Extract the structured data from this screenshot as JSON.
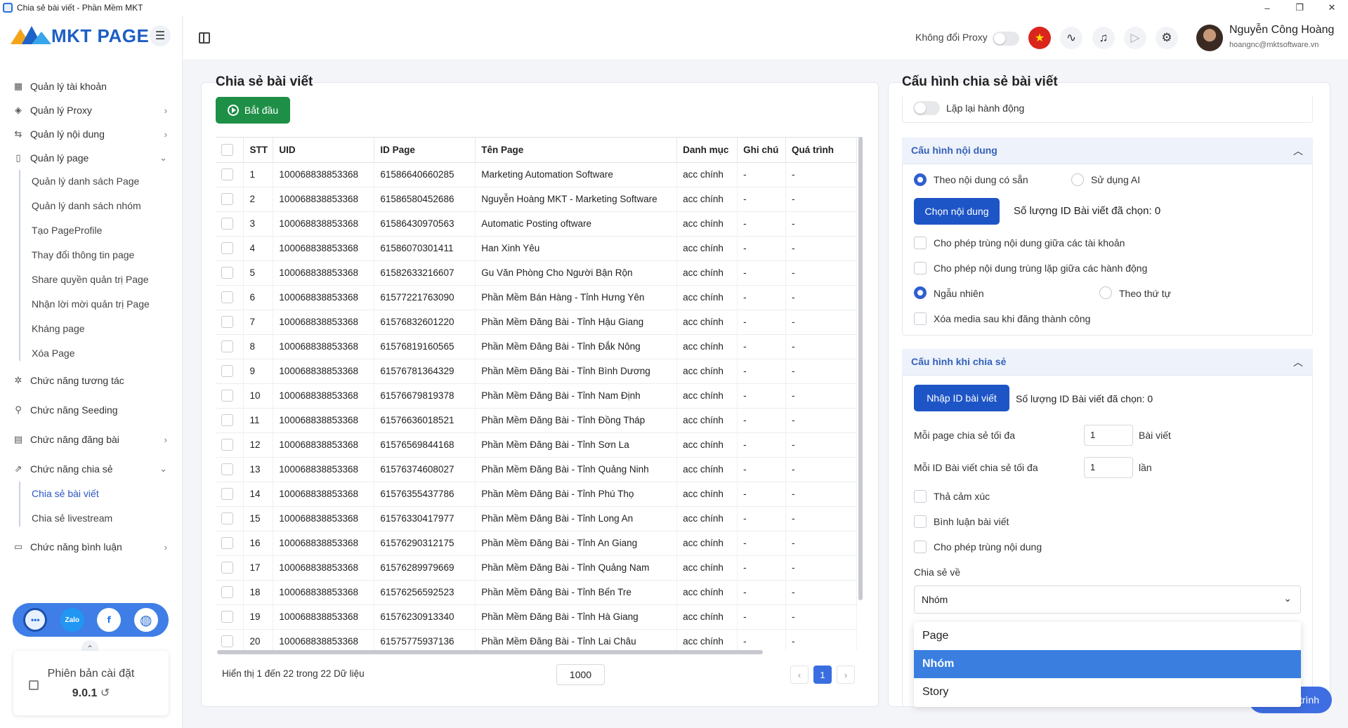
{
  "window": {
    "title": "Chia sẻ bài viết - Phần Mềm MKT",
    "minimize": "–",
    "maximize": "❐",
    "close": "✕"
  },
  "brand": {
    "name": "MKT PAGE"
  },
  "sidebar": {
    "items": [
      {
        "label": "Quản lý tài khoản",
        "icon": "grid-icon"
      },
      {
        "label": "Quản lý Proxy",
        "icon": "layers-icon"
      },
      {
        "label": "Quản lý nội dung",
        "icon": "shuffle-icon"
      },
      {
        "label": "Quản lý page",
        "icon": "document-icon"
      },
      {
        "label": "Chức năng tương tác",
        "icon": "sparkle-icon"
      },
      {
        "label": "Chức năng Seeding",
        "icon": "seed-icon"
      },
      {
        "label": "Chức năng đăng bài",
        "icon": "post-icon"
      },
      {
        "label": "Chức năng chia sẻ",
        "icon": "share-icon"
      },
      {
        "label": "Chức năng bình luận",
        "icon": "comment-icon"
      }
    ],
    "page_subitems": [
      "Quản lý danh sách Page",
      "Quản lý danh sách nhóm",
      "Tạo PageProfile",
      "Thay đổi thông tin page",
      "Share quyền quản trị Page",
      "Nhận lời mời quản trị Page",
      "Kháng page",
      "Xóa Page"
    ],
    "share_subitems": [
      "Chia sẻ bài viết",
      "Chia sẻ livestream"
    ],
    "social": {
      "zalo": "Zalo",
      "facebook": "f"
    },
    "version_label": "Phiên bản cài đặt",
    "version": "9.0.1"
  },
  "header": {
    "proxy_label": "Không đổi Proxy",
    "user_name": "Nguyễn Công Hoàng",
    "user_email": "hoangnc@mktsoftware.vn"
  },
  "left": {
    "title": "Chia sẻ bài viết",
    "start_button": "Bắt đầu",
    "columns": [
      "STT",
      "UID",
      "ID Page",
      "Tên Page",
      "Danh mục",
      "Ghi chú",
      "Quá trình"
    ],
    "rows": [
      [
        "1",
        "100068838853368",
        "61586640660285",
        "Marketing Automation Software",
        "acc chính",
        "-",
        "-"
      ],
      [
        "2",
        "100068838853368",
        "61586580452686",
        "Nguyễn Hoàng MKT - Marketing Software",
        "acc chính",
        "-",
        "-"
      ],
      [
        "3",
        "100068838853368",
        "61586430970563",
        "Automatic Posting oftware",
        "acc chính",
        "-",
        "-"
      ],
      [
        "4",
        "100068838853368",
        "61586070301411",
        "Han Xinh Yêu",
        "acc chính",
        "-",
        "-"
      ],
      [
        "5",
        "100068838853368",
        "61582633216607",
        "Gu Văn Phòng Cho Người Bận Rộn",
        "acc chính",
        "-",
        "-"
      ],
      [
        "6",
        "100068838853368",
        "61577221763090",
        "Phần Mềm Bán Hàng - Tỉnh Hưng Yên",
        "acc chính",
        "-",
        "-"
      ],
      [
        "7",
        "100068838853368",
        "61576832601220",
        "Phần Mềm Đăng Bài - Tỉnh Hậu Giang",
        "acc chính",
        "-",
        "-"
      ],
      [
        "8",
        "100068838853368",
        "61576819160565",
        "Phần Mềm Đăng Bài - Tỉnh Đắk Nông",
        "acc chính",
        "-",
        "-"
      ],
      [
        "9",
        "100068838853368",
        "61576781364329",
        "Phần Mềm Đăng Bài - Tỉnh Bình Dương",
        "acc chính",
        "-",
        "-"
      ],
      [
        "10",
        "100068838853368",
        "61576679819378",
        "Phần Mềm Đăng Bài - Tỉnh Nam Định",
        "acc chính",
        "-",
        "-"
      ],
      [
        "11",
        "100068838853368",
        "61576636018521",
        "Phần Mềm Đăng Bài - Tỉnh Đồng Tháp",
        "acc chính",
        "-",
        "-"
      ],
      [
        "12",
        "100068838853368",
        "61576569844168",
        "Phần Mềm Đăng Bài - Tỉnh Sơn La",
        "acc chính",
        "-",
        "-"
      ],
      [
        "13",
        "100068838853368",
        "61576374608027",
        "Phần Mềm Đăng Bài - Tỉnh Quảng Ninh",
        "acc chính",
        "-",
        "-"
      ],
      [
        "14",
        "100068838853368",
        "61576355437786",
        "Phần Mềm Đăng Bài - Tỉnh Phú Thọ",
        "acc chính",
        "-",
        "-"
      ],
      [
        "15",
        "100068838853368",
        "61576330417977",
        "Phần Mềm Đăng Bài - Tỉnh Long An",
        "acc chính",
        "-",
        "-"
      ],
      [
        "16",
        "100068838853368",
        "61576290312175",
        "Phần Mềm Đăng Bài - Tỉnh An Giang",
        "acc chính",
        "-",
        "-"
      ],
      [
        "17",
        "100068838853368",
        "61576289979669",
        "Phần Mềm Đăng Bài - Tỉnh Quảng Nam",
        "acc chính",
        "-",
        "-"
      ],
      [
        "18",
        "100068838853368",
        "61576256592523",
        "Phần Mềm Đăng Bài - Tỉnh Bến Tre",
        "acc chính",
        "-",
        "-"
      ],
      [
        "19",
        "100068838853368",
        "61576230913340",
        "Phần Mềm Đăng Bài - Tỉnh Hà Giang",
        "acc chính",
        "-",
        "-"
      ],
      [
        "20",
        "100068838853368",
        "61575775937136",
        "Phần Mềm Đăng Bài - Tỉnh Lai Châu",
        "acc chính",
        "-",
        "-"
      ]
    ],
    "footer_info": "Hiển thị 1 đến 22 trong 22 Dữ liệu",
    "page_size": "1000",
    "page_prev": "‹",
    "page_current": "1",
    "page_next": "›"
  },
  "right": {
    "title": "Cấu hình chia sẻ bài viết",
    "repeat_label": "Lặp lại hành động",
    "content_section": {
      "title": "Cấu hình nội dung",
      "radio_available": "Theo nội dung có sẵn",
      "radio_ai": "Sử dụng AI",
      "choose_button": "Chọn nội dung",
      "count_label": "Số lượng ID Bài viết đã chọn: 0",
      "allow_dup_accounts": "Cho phép trùng nội dung giữa các tài khoản",
      "allow_dup_actions": "Cho phép nội dung trùng lặp giữa các hành động",
      "radio_random": "Ngẫu nhiên",
      "radio_order": "Theo thứ tự",
      "delete_media": "Xóa media sau khi đăng thành công"
    },
    "share_section": {
      "title": "Cấu hình khi chia sẻ",
      "import_button": "Nhập ID bài viết",
      "count_label": "Số lượng ID Bài viết đã chọn: 0",
      "max_per_page_label": "Mỗi page chia sẻ tối đa",
      "max_per_page_value": "1",
      "max_per_page_unit": "Bài viết",
      "max_per_post_label": "Mỗi ID Bài viết chia sẻ tối đa",
      "max_per_post_value": "1",
      "max_per_post_unit": "lần",
      "react": "Thả cảm xúc",
      "comment": "Bình luận bài viết",
      "allow_dup": "Cho phép trùng nội dung",
      "share_to_label": "Chia sẻ về",
      "share_to_value": "Nhóm",
      "options": [
        "Page",
        "Nhóm",
        "Story"
      ]
    },
    "fab_label": "trình"
  },
  "colors": {
    "primary": "#1e55c6",
    "start_green": "#1e8f46",
    "section_head_bg": "#edf2fb",
    "dropdown_selected": "#3a7fe0"
  }
}
